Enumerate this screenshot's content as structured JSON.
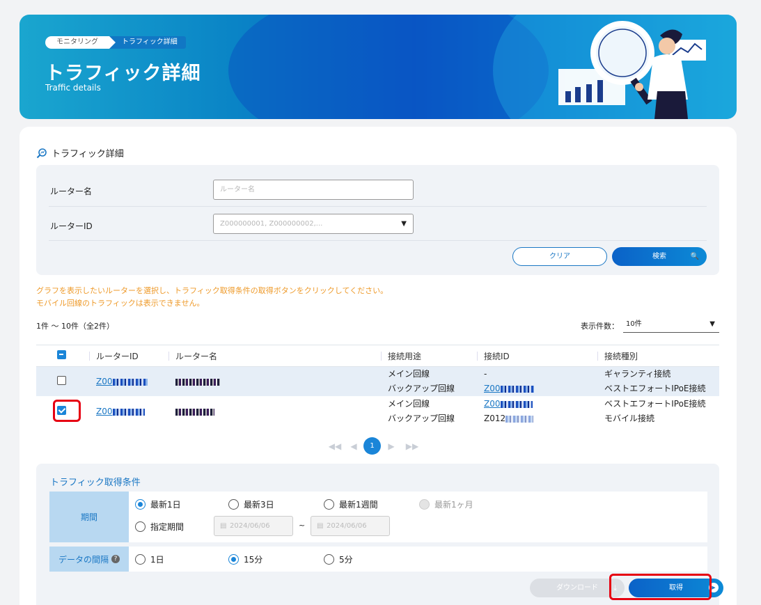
{
  "breadcrumb": {
    "parent": "モニタリング",
    "current": "トラフィック詳細"
  },
  "hero": {
    "title": "トラフィック詳細",
    "subtitle": "Traffic details"
  },
  "section": {
    "title": "トラフィック詳細"
  },
  "search": {
    "router_name_label": "ルーター名",
    "router_name_placeholder": "ルーター名",
    "router_id_label": "ルーターID",
    "router_id_placeholder": "Z000000001, Z000000002,...",
    "clear_label": "クリア",
    "search_label": "検索"
  },
  "notice": {
    "line1": "グラフを表示したいルーターを選択し、トラフィック取得条件の取得ボタンをクリックしてください。",
    "line2": "モバイル回線のトラフィックは表示できません。"
  },
  "list": {
    "count_text": "1件 〜 10件（全2件）",
    "per_page_label": "表示件数：",
    "per_page_value": "10件",
    "headers": [
      "ルーターID",
      "ルーター名",
      "接続用途",
      "接続ID",
      "接続種別"
    ],
    "rows": [
      {
        "router_id": "Z00",
        "checked": false,
        "lines": [
          {
            "use": "メイン回線",
            "conn_id": "-",
            "type": "ギャランティ接続"
          },
          {
            "use": "バックアップ回線",
            "conn_id": "Z00",
            "type": "ベストエフォートIPoE接続"
          }
        ]
      },
      {
        "router_id": "Z00",
        "checked": true,
        "lines": [
          {
            "use": "メイン回線",
            "conn_id": "Z00",
            "type": "ベストエフォートIPoE接続"
          },
          {
            "use": "バックアップ回線",
            "conn_id": "Z012",
            "type": "モバイル接続"
          }
        ]
      }
    ]
  },
  "pager": {
    "current": "1"
  },
  "conditions": {
    "title": "トラフィック取得条件",
    "period_label": "期間",
    "period_options": [
      "最新1日",
      "最新3日",
      "最新1週間",
      "最新1ヶ月"
    ],
    "custom_label": "指定期間",
    "date_from": "2024/06/06",
    "date_to": "2024/06/06",
    "range_sep": "~",
    "interval_label": "データの間隔",
    "interval_options": [
      "1日",
      "15分",
      "5分"
    ],
    "download_label": "ダウンロード",
    "get_label": "取得"
  },
  "colors": {
    "accent": "#1a77c4",
    "notice": "#ee9a2a",
    "highlight": "#e60012"
  }
}
